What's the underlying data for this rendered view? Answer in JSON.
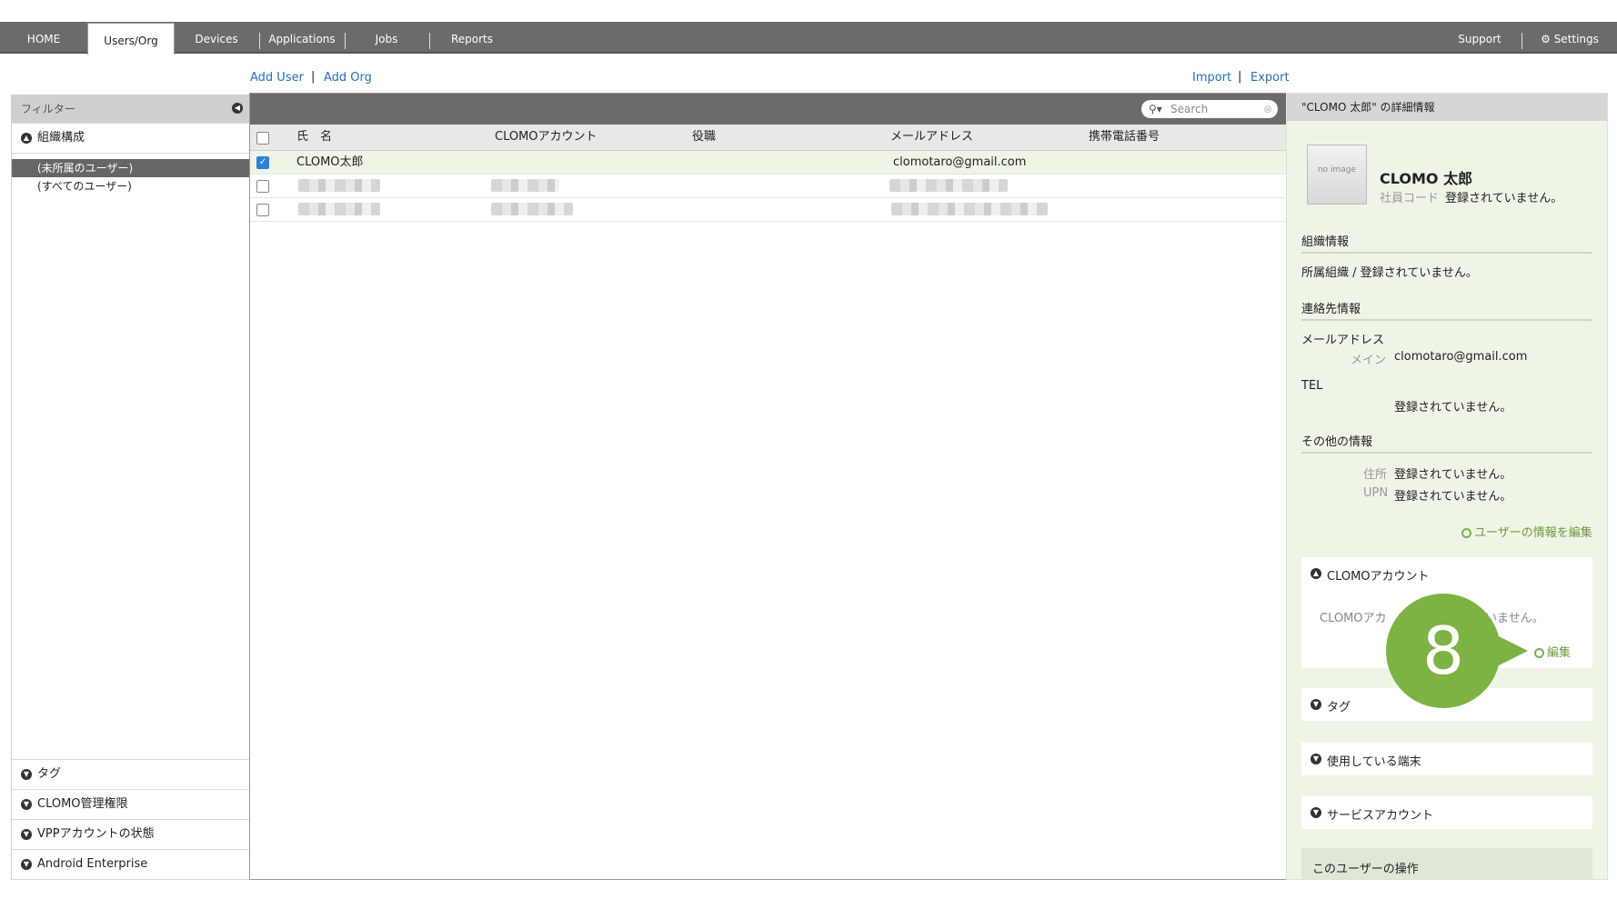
{
  "nav": {
    "tabs": [
      "HOME",
      "Users/Org",
      "Devices",
      "Applications",
      "Jobs",
      "Reports"
    ],
    "active": "Users/Org",
    "right": [
      "Support",
      "Settings"
    ]
  },
  "actions": {
    "add_user": "Add User",
    "add_org": "Add Org",
    "import": "Import",
    "export": "Export",
    "sep": "|"
  },
  "filter": {
    "title": "フィルター",
    "org_section": "組織構成",
    "tree": [
      "(未所属のユーザー)",
      "(すべてのユーザー)"
    ],
    "bottom_sections": [
      "タグ",
      "CLOMO管理権限",
      "VPPアカウントの状態",
      "Android Enterprise"
    ]
  },
  "table": {
    "search_placeholder": "Search",
    "columns": [
      "氏　名",
      "CLOMOアカウント",
      "役職",
      "メールアドレス",
      "携帯電話番号"
    ],
    "rows": [
      {
        "name": "CLOMO太郎",
        "email": "clomotaro@gmail.com",
        "checked": true
      }
    ]
  },
  "details": {
    "title": "\"CLOMO 太郎\" の詳細情報",
    "avatar_text": "no image",
    "name": "CLOMO 太郎",
    "employee_code_label": "社員コード",
    "employee_code_value": "登録されていません。",
    "org_heading": "組織情報",
    "org_line": "所属組織 / 登録されていません。",
    "contact_heading": "連絡先情報",
    "email_label": "メールアドレス",
    "email_main_label": "メイン",
    "email_main_value": "clomotaro@gmail.com",
    "tel_label": "TEL",
    "tel_value": "登録されていません。",
    "other_heading": "その他の情報",
    "address_label": "住所",
    "address_value": "登録されていません。",
    "upn_label": "UPN",
    "upn_value": "登録されていません。",
    "edit_user": "ユーザーの情報を編集",
    "clomo_account_title": "CLOMOアカウント",
    "clomo_account_text_left": "CLOMOアカ",
    "clomo_account_text_right": "いません。",
    "edit": "編集",
    "tag_title": "タグ",
    "devices_title": "使用している端末",
    "service_title": "サービスアカウント",
    "actions_title": "このユーザーの操作"
  },
  "badge": "8"
}
